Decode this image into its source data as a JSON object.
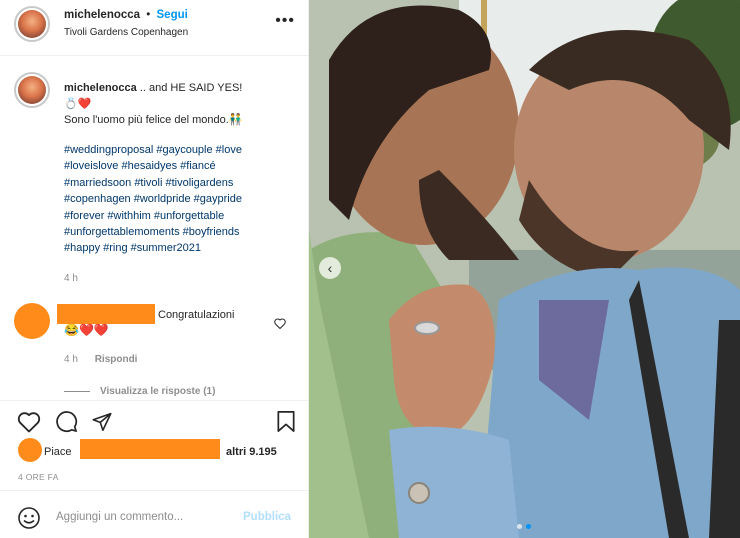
{
  "post": {
    "username": "michelenocca",
    "separator": "•",
    "follow_label": "Segui",
    "location": "Tivoli Gardens Copenhagen",
    "more_label": "•••",
    "caption_title": ".. and HE SAID YES!",
    "caption_emoji": "💍❤️",
    "caption_line2": "Sono l'uomo più felice del mondo.👬",
    "hashtags_lines": [
      "#weddingproposal #gaycouple #love",
      "#loveislove #hesaidyes #fiancé",
      "#marriedsoon #tivoli #tivoligardens",
      "#copenhagen #worldpride #gaypride",
      "#forever #withhim #unforgettable",
      "#unforgettablemoments #boyfriends",
      "#happy #ring #summer2021"
    ],
    "caption_time": "4 h"
  },
  "comment": {
    "text": "Congratulazioni",
    "emoji": "😂❤️❤️",
    "time": "4 h",
    "reply_label": "Rispondi",
    "view_replies": "Visualizza le risposte (1)"
  },
  "likes": {
    "prefix": "Piace",
    "suffix": "altri 9.195",
    "date": "4 ORE FA"
  },
  "composer": {
    "placeholder": "Aggiungi un commento...",
    "publish_label": "Pubblica"
  },
  "colors": {
    "accent": "#0095f6",
    "redaction": "#ff8c1a",
    "hashtag": "#00376b"
  },
  "icons": [
    "heart-icon",
    "comment-icon",
    "share-icon",
    "bookmark-icon",
    "emoji-icon",
    "carousel-prev-icon"
  ]
}
